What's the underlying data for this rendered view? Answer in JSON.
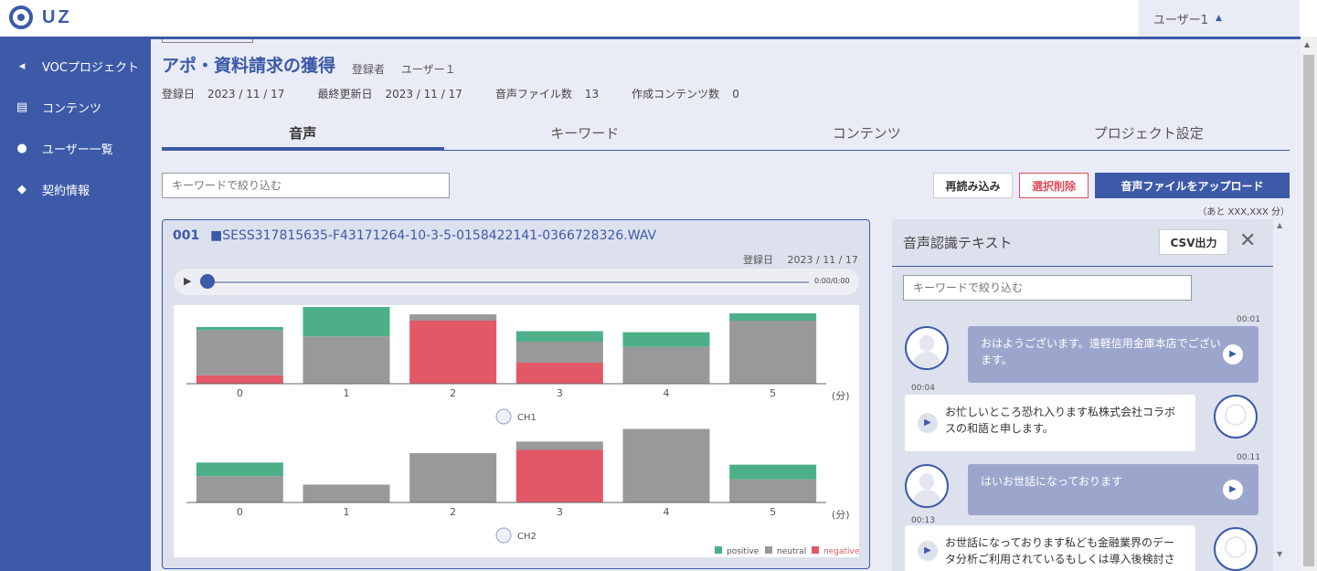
{
  "app": {
    "logo_text": "UZ",
    "user_menu": "ユーザー1",
    "user_menu_caret": "▲"
  },
  "sidebar": {
    "items": [
      {
        "label": "VOCプロジェクト",
        "icon": "megaphone-icon",
        "glyph": "◂"
      },
      {
        "label": "コンテンツ",
        "icon": "document-icon",
        "glyph": "▤"
      },
      {
        "label": "ユーザー一覧",
        "icon": "users-icon",
        "glyph": "●"
      },
      {
        "label": "契約情報",
        "icon": "handshake-icon",
        "glyph": "◆"
      }
    ]
  },
  "project": {
    "title": "アポ・資料請求の獲得",
    "registrant_label": "登録者",
    "registrant": "ユーザー１",
    "registered_label": "登録日",
    "registered": "2023 / 11 / 17",
    "updated_label": "最終更新日",
    "updated": "2023 / 11 / 17",
    "audio_count_label": "音声ファイル数",
    "audio_count": "13",
    "content_count_label": "作成コンテンツ数",
    "content_count": "0"
  },
  "tabs": [
    {
      "label": "音声",
      "active": true
    },
    {
      "label": "キーワード",
      "active": false
    },
    {
      "label": "コンテンツ",
      "active": false
    },
    {
      "label": "プロジェクト設定",
      "active": false
    }
  ],
  "toolbar": {
    "filter_placeholder": "キーワードで絞り込む",
    "reload_label": "再読み込み",
    "delete_label": "選択削除",
    "upload_label": "音声ファイルをアップロード",
    "remaining": "（あと XXX,XXX 分）"
  },
  "audio_card": {
    "number": "001",
    "filename": "■SESS317815635-F43171264-10-3-5-0158422141-0366728326.WAV",
    "date_label": "登録日",
    "date": "2023 / 11 / 17",
    "time": "0:00/0:00"
  },
  "chart_data": {
    "type": "bar",
    "stacked": true,
    "x_unit": "(分)",
    "categories": [
      "0",
      "1",
      "2",
      "3",
      "4",
      "5"
    ],
    "colors": {
      "positive": "#4caf88",
      "neutral": "#999999",
      "negative": "#e25866"
    },
    "legend": [
      "positive",
      "neutral",
      "negative"
    ],
    "legend_position": "bottom-right",
    "ylim": [
      0,
      80
    ],
    "charts": [
      {
        "channel": "CH1",
        "series": [
          {
            "name": "negative",
            "values": [
              8,
              0,
              60,
              20,
              0,
              0
            ]
          },
          {
            "name": "neutral",
            "values": [
              43,
              45,
              6,
              20,
              35,
              60
            ]
          },
          {
            "name": "positive",
            "values": [
              3,
              28,
              0,
              10,
              14,
              7
            ]
          }
        ]
      },
      {
        "channel": "CH2",
        "series": [
          {
            "name": "negative",
            "values": [
              0,
              0,
              0,
              50,
              0,
              0
            ]
          },
          {
            "name": "neutral",
            "values": [
              25,
              17,
              47,
              8,
              70,
              22
            ]
          },
          {
            "name": "positive",
            "values": [
              13,
              0,
              0,
              0,
              0,
              14
            ]
          }
        ]
      }
    ]
  },
  "transcript": {
    "title": "音声認識テキスト",
    "csv_label": "CSV出力",
    "close_glyph": "✕",
    "filter_placeholder": "キーワードで絞り込む",
    "messages": [
      {
        "speaker": "customer",
        "time": "00:01",
        "text": "おはようございます。遠軽信用金庫本店でございます。"
      },
      {
        "speaker": "operator",
        "time": "00:04",
        "text": "お忙しいところ恐れ入ります私株式会社コラボスの和語と申します。"
      },
      {
        "speaker": "customer",
        "time": "00:11",
        "text": "はいお世話になっております"
      },
      {
        "speaker": "operator",
        "time": "00:13",
        "text": "お世話になっております私ども金融業界のデータ分析ご利用されているもしくは導入後検討さ"
      }
    ]
  },
  "glyphs": {
    "play": "▶",
    "scroll_up": "▲",
    "scroll_down": "▼"
  }
}
